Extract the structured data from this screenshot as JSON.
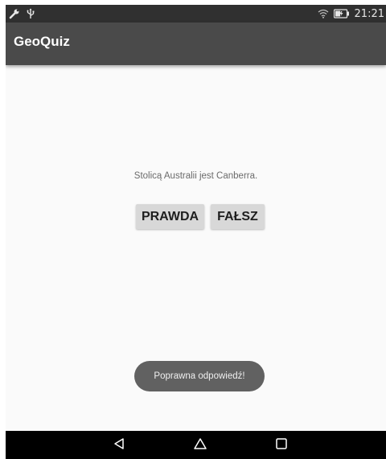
{
  "status_bar": {
    "time": "21:21",
    "icons": [
      "wrench-icon",
      "usb-icon",
      "wifi-icon",
      "battery-icon"
    ]
  },
  "app_bar": {
    "title": "GeoQuiz"
  },
  "quiz": {
    "question": "Stolicą Australii jest Canberra.",
    "true_label": "PRAWDA",
    "false_label": "FAŁSZ"
  },
  "toast": {
    "message": "Poprawna odpowiedź!"
  },
  "nav_bar": {
    "icons": [
      "back-icon",
      "home-icon",
      "recent-apps-icon"
    ]
  },
  "colors": {
    "status_bar": "#303030",
    "app_bar": "#4a4a4a",
    "background": "#fafafa",
    "button": "#d8d8d8",
    "toast": "#616161",
    "nav_bar": "#000000"
  }
}
